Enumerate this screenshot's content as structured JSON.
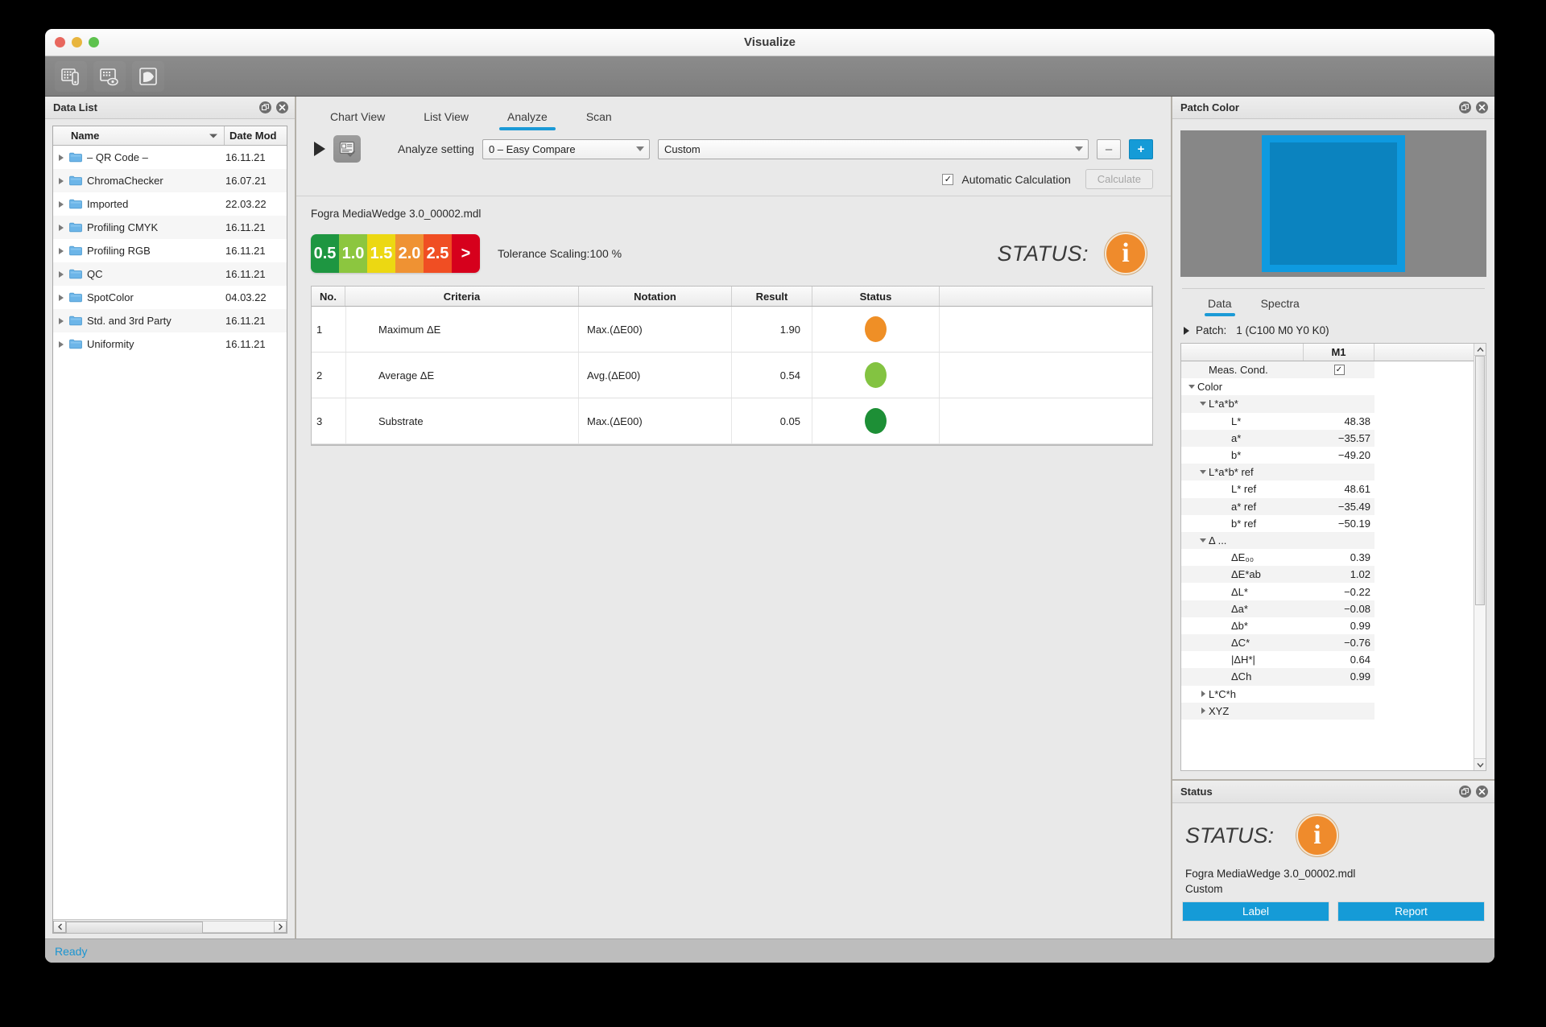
{
  "window": {
    "title": "Visualize"
  },
  "traffic": {
    "close": "close-button",
    "minimize": "minimize-button",
    "zoom": "zoom-button"
  },
  "toolbar": {
    "buttons": [
      {
        "name": "measure-chart-icon",
        "tip": "Measure"
      },
      {
        "name": "view-chart-icon",
        "tip": "View"
      },
      {
        "name": "spectra-graph-icon",
        "tip": "Spectra"
      }
    ]
  },
  "data_list": {
    "panel_title": "Data List",
    "columns": {
      "name": "Name",
      "date": "Date Mod"
    },
    "rows": [
      {
        "name": "– QR Code –",
        "date": "16.11.21"
      },
      {
        "name": "ChromaChecker",
        "date": "16.07.21"
      },
      {
        "name": "Imported",
        "date": "22.03.22"
      },
      {
        "name": "Profiling CMYK",
        "date": "16.11.21"
      },
      {
        "name": "Profiling RGB",
        "date": "16.11.21"
      },
      {
        "name": "QC",
        "date": "16.11.21"
      },
      {
        "name": "SpotColor",
        "date": "04.03.22"
      },
      {
        "name": "Std. and 3rd Party",
        "date": "16.11.21"
      },
      {
        "name": "Uniformity",
        "date": "16.11.21"
      }
    ]
  },
  "center": {
    "tabs": [
      {
        "label": "Chart View",
        "active": false
      },
      {
        "label": "List View",
        "active": false
      },
      {
        "label": "Analyze",
        "active": true
      },
      {
        "label": "Scan",
        "active": false
      }
    ],
    "analyze_setting_label": "Analyze setting",
    "analyze_setting_value": "0 – Easy Compare",
    "custom_value": "Custom",
    "minus_label": "–",
    "plus_label": "+",
    "automatic_calculation_label": "Automatic Calculation",
    "automatic_calculation_checked": "✓",
    "calculate_label": "Calculate",
    "file_name": "Fogra MediaWedge 3.0_00002.mdl",
    "tolerance_scale": {
      "segments": [
        {
          "label": "0.5",
          "color": "#1e9641"
        },
        {
          "label": "1.0",
          "color": "#8cc63f"
        },
        {
          "label": "1.5",
          "color": "#ecd812"
        },
        {
          "label": "2.0",
          "color": "#ef9233"
        },
        {
          "label": "2.5",
          "color": "#f04e23"
        },
        {
          "label": ">",
          "color": "#d6001c"
        }
      ]
    },
    "tolerance_text": "Tolerance Scaling:100 %",
    "status_word": "STATUS:",
    "status_color": "#ef8b2c"
  },
  "results": {
    "columns": [
      "No.",
      "Criteria",
      "Notation",
      "Result",
      "Status"
    ],
    "rows": [
      {
        "no": "1",
        "criteria": "Maximum ΔE",
        "notation": "Max.(ΔE00)",
        "result": "1.90",
        "status_color": "#ef8f26"
      },
      {
        "no": "2",
        "criteria": "Average ΔE",
        "notation": "Avg.(ΔE00)",
        "result": "0.54",
        "status_color": "#83c341"
      },
      {
        "no": "3",
        "criteria": "Substrate",
        "notation": "Max.(ΔE00)",
        "result": "0.05",
        "status_color": "#1d8f36"
      }
    ]
  },
  "patch_color": {
    "panel_title": "Patch Color",
    "swatch_background": "#878787",
    "swatch_outer": "#0e9ae0",
    "swatch_inner": "#0b83bf",
    "tabs": [
      {
        "label": "Data",
        "active": true
      },
      {
        "label": "Spectra",
        "active": false
      }
    ],
    "patch_label": "Patch:",
    "patch_value": "1 (C100 M0 Y0 K0)",
    "tree_column": "M1",
    "tree": [
      {
        "label": "Meas. Cond.",
        "indent": 1,
        "twist": "none",
        "value": "✓",
        "value_type": "check"
      },
      {
        "label": "Color",
        "indent": 0,
        "twist": "down",
        "value": ""
      },
      {
        "label": "L*a*b*",
        "indent": 1,
        "twist": "down",
        "value": ""
      },
      {
        "label": "L*",
        "indent": 3,
        "twist": "none",
        "value": "48.38"
      },
      {
        "label": "a*",
        "indent": 3,
        "twist": "none",
        "value": "−35.57"
      },
      {
        "label": "b*",
        "indent": 3,
        "twist": "none",
        "value": "−49.20"
      },
      {
        "label": "L*a*b* ref",
        "indent": 1,
        "twist": "down",
        "value": ""
      },
      {
        "label": "L* ref",
        "indent": 3,
        "twist": "none",
        "value": "48.61"
      },
      {
        "label": "a* ref",
        "indent": 3,
        "twist": "none",
        "value": "−35.49"
      },
      {
        "label": "b* ref",
        "indent": 3,
        "twist": "none",
        "value": "−50.19"
      },
      {
        "label": "Δ ...",
        "indent": 1,
        "twist": "down",
        "value": ""
      },
      {
        "label": "ΔE₀₀",
        "indent": 3,
        "twist": "none",
        "value": "0.39"
      },
      {
        "label": "ΔE*ab",
        "indent": 3,
        "twist": "none",
        "value": "1.02"
      },
      {
        "label": "ΔL*",
        "indent": 3,
        "twist": "none",
        "value": "−0.22"
      },
      {
        "label": "Δa*",
        "indent": 3,
        "twist": "none",
        "value": "−0.08"
      },
      {
        "label": "Δb*",
        "indent": 3,
        "twist": "none",
        "value": "0.99"
      },
      {
        "label": "ΔC*",
        "indent": 3,
        "twist": "none",
        "value": "−0.76"
      },
      {
        "label": "|ΔH*|",
        "indent": 3,
        "twist": "none",
        "value": "0.64"
      },
      {
        "label": "ΔCh",
        "indent": 3,
        "twist": "none",
        "value": "0.99"
      },
      {
        "label": "L*C*h",
        "indent": 1,
        "twist": "right",
        "value": ""
      },
      {
        "label": "XYZ",
        "indent": 1,
        "twist": "right",
        "value": ""
      }
    ]
  },
  "status_panel": {
    "panel_title": "Status",
    "status_word": "STATUS:",
    "status_color": "#ef8b2c",
    "file_name": "Fogra MediaWedge 3.0_00002.mdl",
    "setting_name": "Custom",
    "label_button": "Label",
    "report_button": "Report"
  },
  "statusbar": {
    "text": "Ready"
  }
}
